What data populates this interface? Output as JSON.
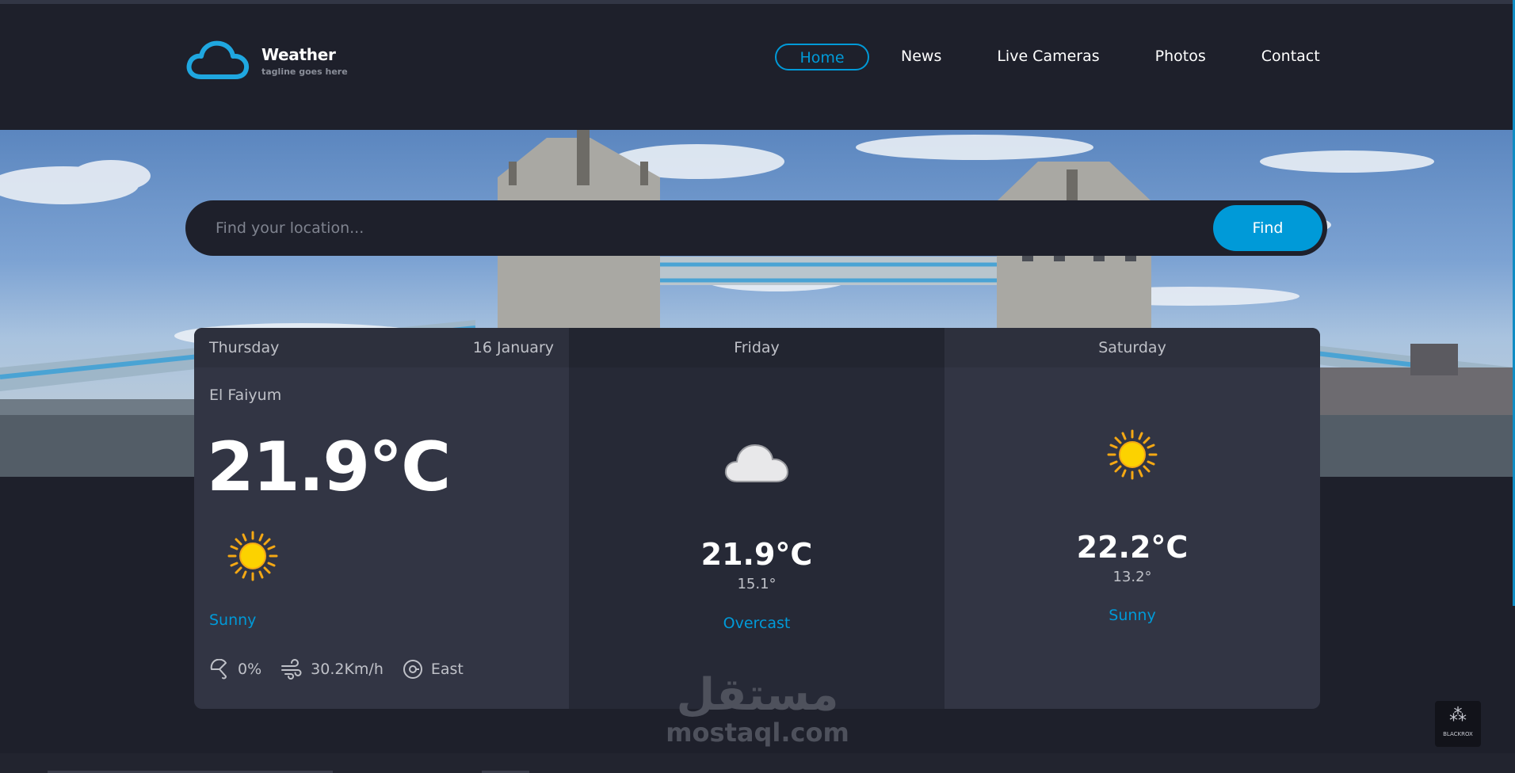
{
  "brand": {
    "title": "Weather",
    "tagline": "tagline goes here",
    "accent": "#009ad8"
  },
  "nav": {
    "items": [
      "Home",
      "News",
      "Live Cameras",
      "Photos",
      "Contact"
    ],
    "active": "Home"
  },
  "search": {
    "placeholder": "Find your location...",
    "button": "Find"
  },
  "forecast": {
    "today": {
      "day": "Thursday",
      "date": "16 January",
      "location": "El Faiyum",
      "temp": "21.9°C",
      "icon": "sun-icon",
      "condition": "Sunny",
      "rain": "0%",
      "wind": "30.2Km/h",
      "direction": "East"
    },
    "days": [
      {
        "day": "Friday",
        "icon": "cloud-icon",
        "temp": "21.9°C",
        "low": "15.1°",
        "condition": "Overcast"
      },
      {
        "day": "Saturday",
        "icon": "sun-icon",
        "temp": "22.2°C",
        "low": "13.2°",
        "condition": "Sunny"
      }
    ]
  },
  "watermark": {
    "logo": "مستقل",
    "url": "mostaql.com"
  },
  "badge": {
    "label": "BLACKROX"
  }
}
